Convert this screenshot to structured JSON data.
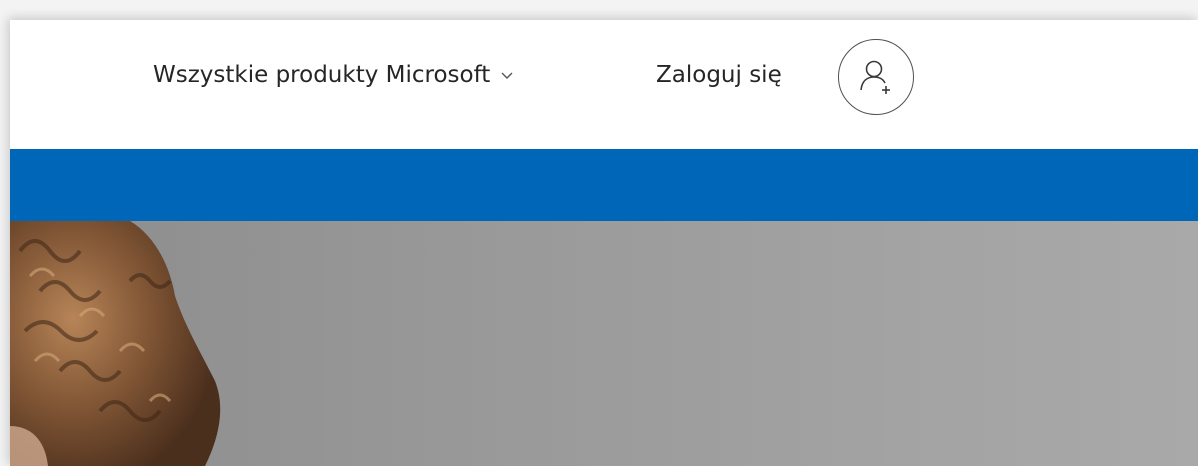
{
  "header": {
    "products_menu_label": "Wszystkie produkty Microsoft",
    "products_menu_icon": "chevron-down-icon",
    "signin_label": "Zaloguj się",
    "avatar_icon": "add-user-icon"
  },
  "colors": {
    "brand_blue": "#0067b8",
    "text": "#262626",
    "hero_gray": "#999999"
  }
}
